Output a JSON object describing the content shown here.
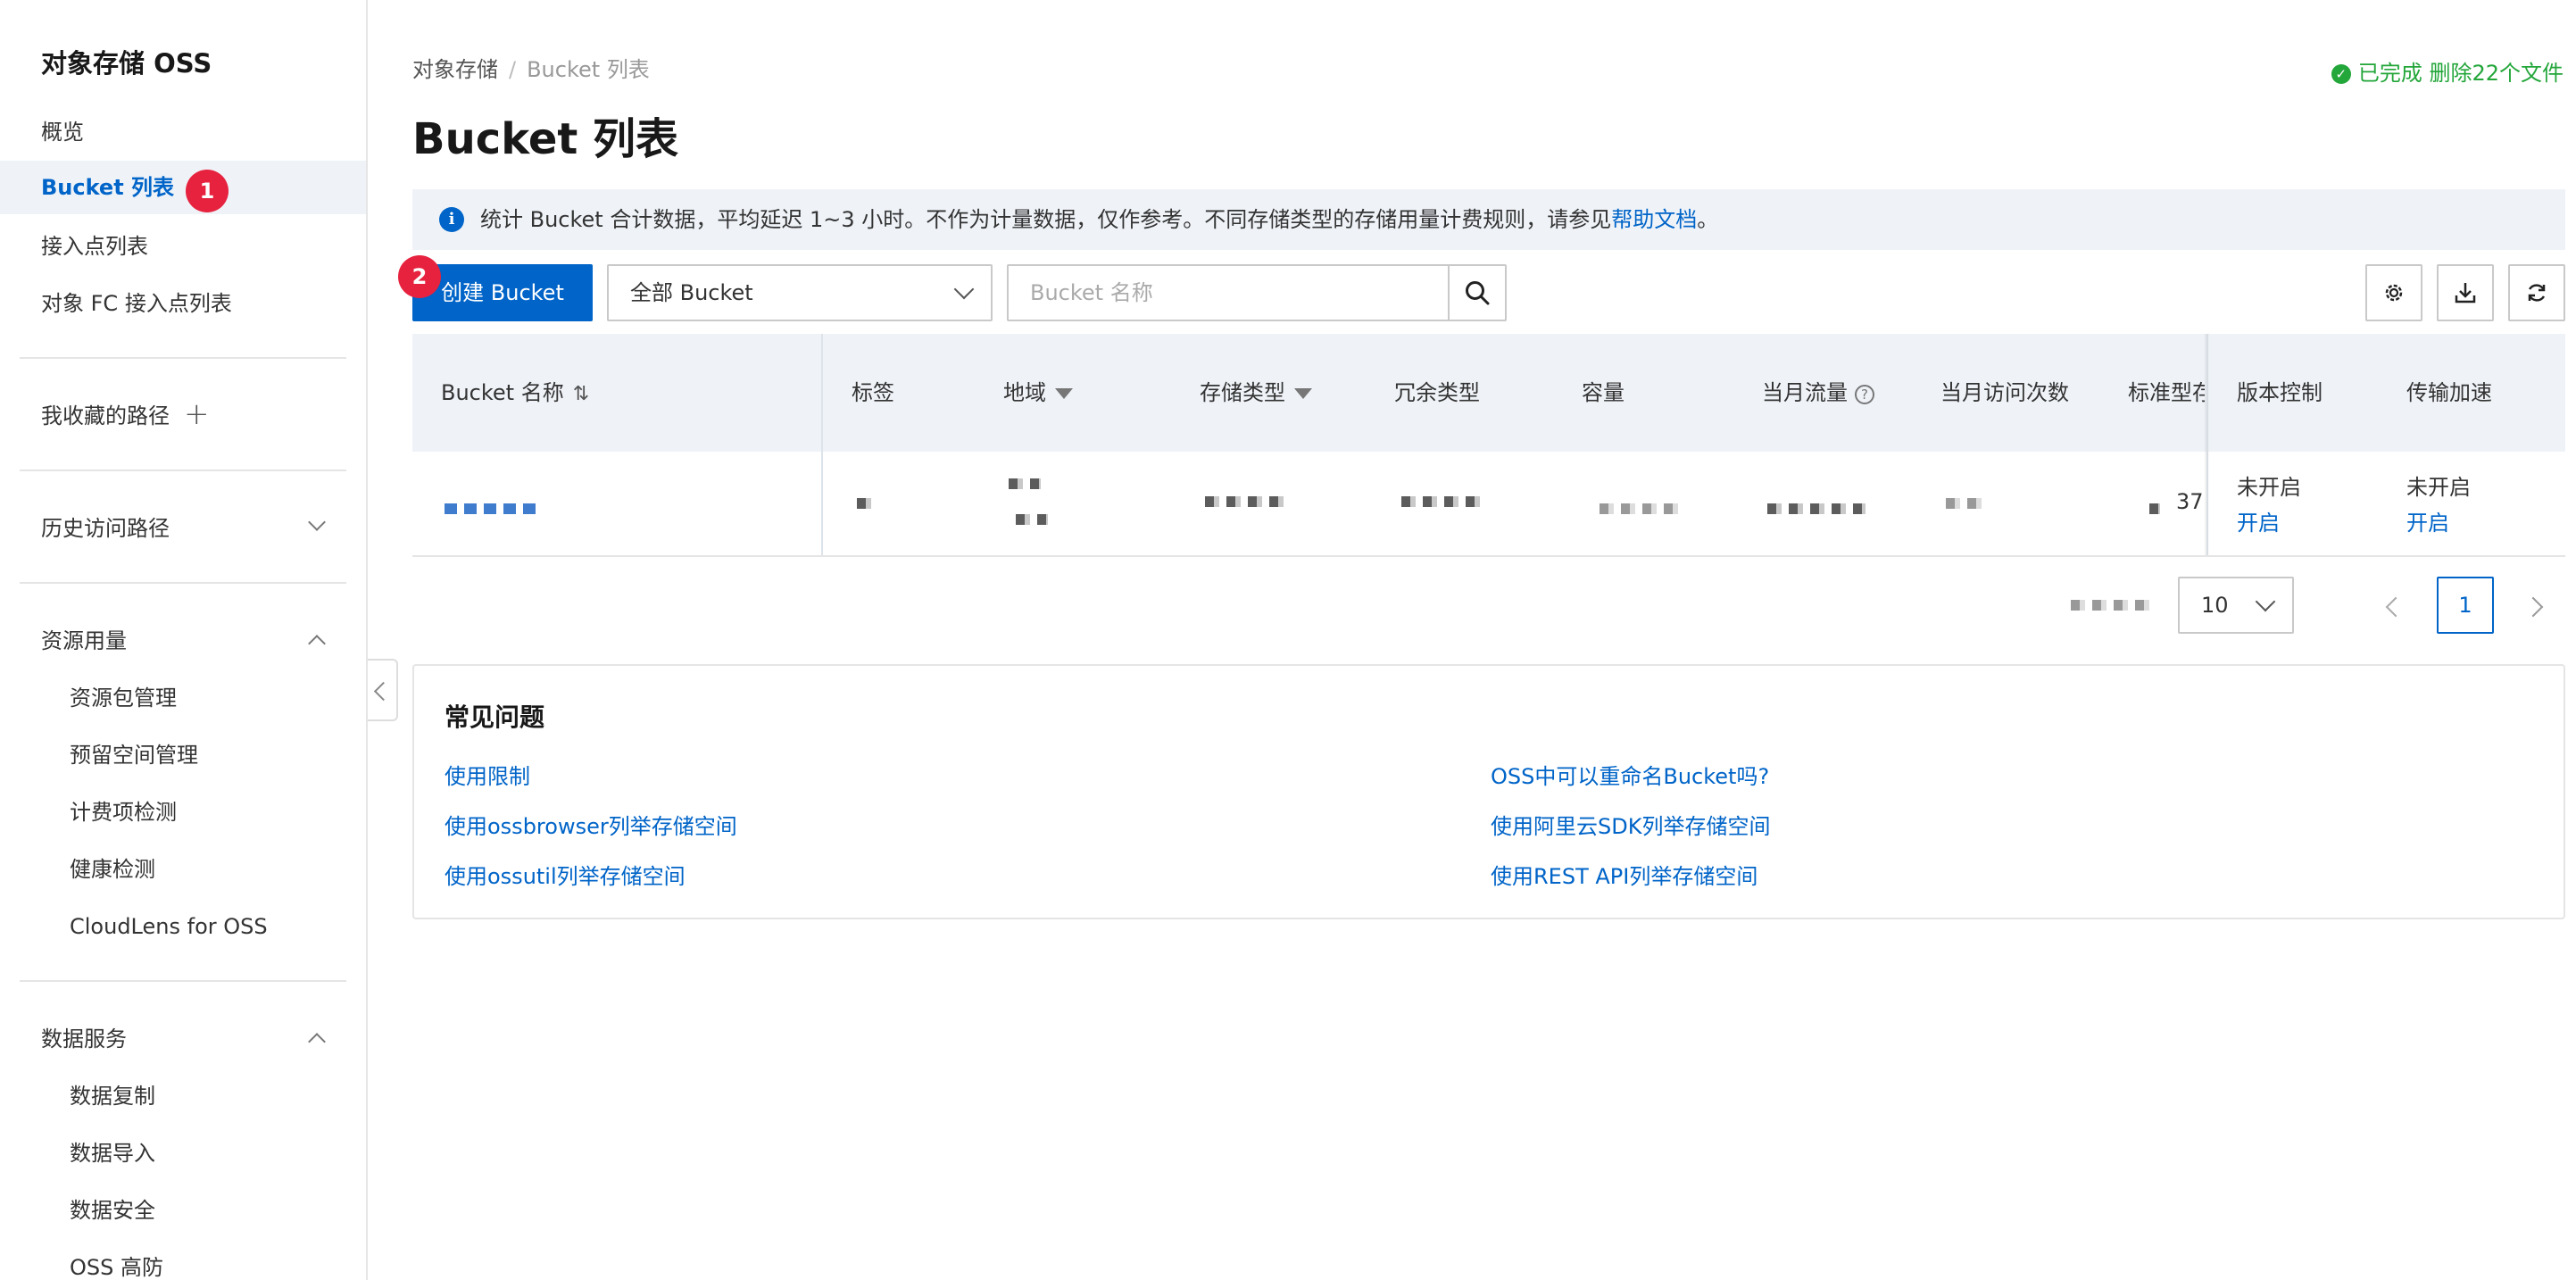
{
  "sidebar": {
    "title": "对象存储 OSS",
    "items": [
      {
        "label": "概览"
      },
      {
        "label": "Bucket 列表",
        "active": true
      },
      {
        "label": "接入点列表"
      },
      {
        "label": "对象 FC 接入点列表"
      }
    ],
    "favorites": {
      "label": "我收藏的路径",
      "add_icon": "plus-icon"
    },
    "history": {
      "label": "历史访问路径",
      "expanded": false
    },
    "resource": {
      "label": "资源用量",
      "expanded": true,
      "items": [
        "资源包管理",
        "预留空间管理",
        "计费项检测",
        "健康检测",
        "CloudLens for OSS"
      ]
    },
    "data_service": {
      "label": "数据服务",
      "expanded": true,
      "items": [
        "数据复制",
        "数据导入",
        "数据安全",
        "OSS 高防"
      ]
    }
  },
  "annotations": {
    "badge1": "1",
    "badge2": "2"
  },
  "breadcrumb": {
    "root": "对象存储",
    "current": "Bucket 列表"
  },
  "status": {
    "text": "已完成 删除22个文件",
    "color": "#23a63a"
  },
  "page_title": "Bucket 列表",
  "notice": {
    "text": "统计 Bucket 合计数据，平均延迟 1~3 小时。不作为计量数据，仅作参考。不同存储类型的存储用量计费规则，请参见",
    "link": "帮助文档",
    "suffix": "。"
  },
  "toolbar": {
    "create_label": "创建 Bucket",
    "filter_value": "全部 Bucket",
    "search_placeholder": "Bucket 名称"
  },
  "table": {
    "columns": {
      "name": "Bucket 名称",
      "tags": "标签",
      "region": "地域",
      "storage_class": "存储类型",
      "redundancy": "冗余类型",
      "capacity": "容量",
      "traffic": "当月流量",
      "visits": "当月访问次数",
      "standard": "标准型存",
      "versioning": "版本控制",
      "acceleration": "传输加速"
    },
    "row": {
      "standard_partial": "37",
      "versioning_status": "未开启",
      "versioning_action": "开启",
      "acceleration_status": "未开启",
      "acceleration_action": "开启"
    }
  },
  "pagination": {
    "page_size": "10",
    "current_page": "1"
  },
  "faq": {
    "title": "常见问题",
    "links": [
      "使用限制",
      "OSS中可以重命名Bucket吗?",
      "使用ossbrowser列举存储空间",
      "使用阿里云SDK列举存储空间",
      "使用ossutil列举存储空间",
      "使用REST API列举存储空间"
    ]
  },
  "colors": {
    "primary": "#0064c8",
    "badge": "#e6223e",
    "header_bg": "#eff3f8"
  }
}
